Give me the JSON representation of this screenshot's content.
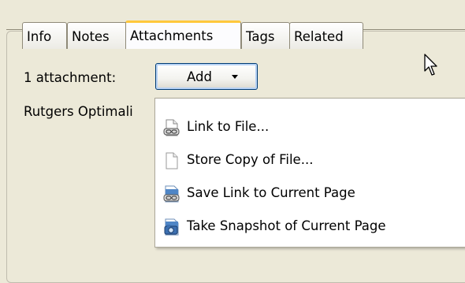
{
  "tabs": [
    {
      "label": "Info",
      "active": false
    },
    {
      "label": "Notes",
      "active": false
    },
    {
      "label": "Attachments",
      "active": true
    },
    {
      "label": "Tags",
      "active": false
    },
    {
      "label": "Related",
      "active": false
    }
  ],
  "attachments": {
    "count_label": "1 attachment:",
    "add_button_label": "Add",
    "item_name": "Rutgers Optimali"
  },
  "menu": {
    "items": [
      {
        "label": "Link to File...",
        "icon": "linked-file-icon"
      },
      {
        "label": "Store Copy of File...",
        "icon": "blank-document-icon"
      },
      {
        "label": "Save Link to Current Page",
        "icon": "web-link-icon"
      },
      {
        "label": "Take Snapshot of Current Page",
        "icon": "snapshot-icon"
      }
    ]
  },
  "colors": {
    "window_bg": "#ece9d8",
    "active_tab_accent": "#ffc83c",
    "button_border": "#003c74"
  }
}
